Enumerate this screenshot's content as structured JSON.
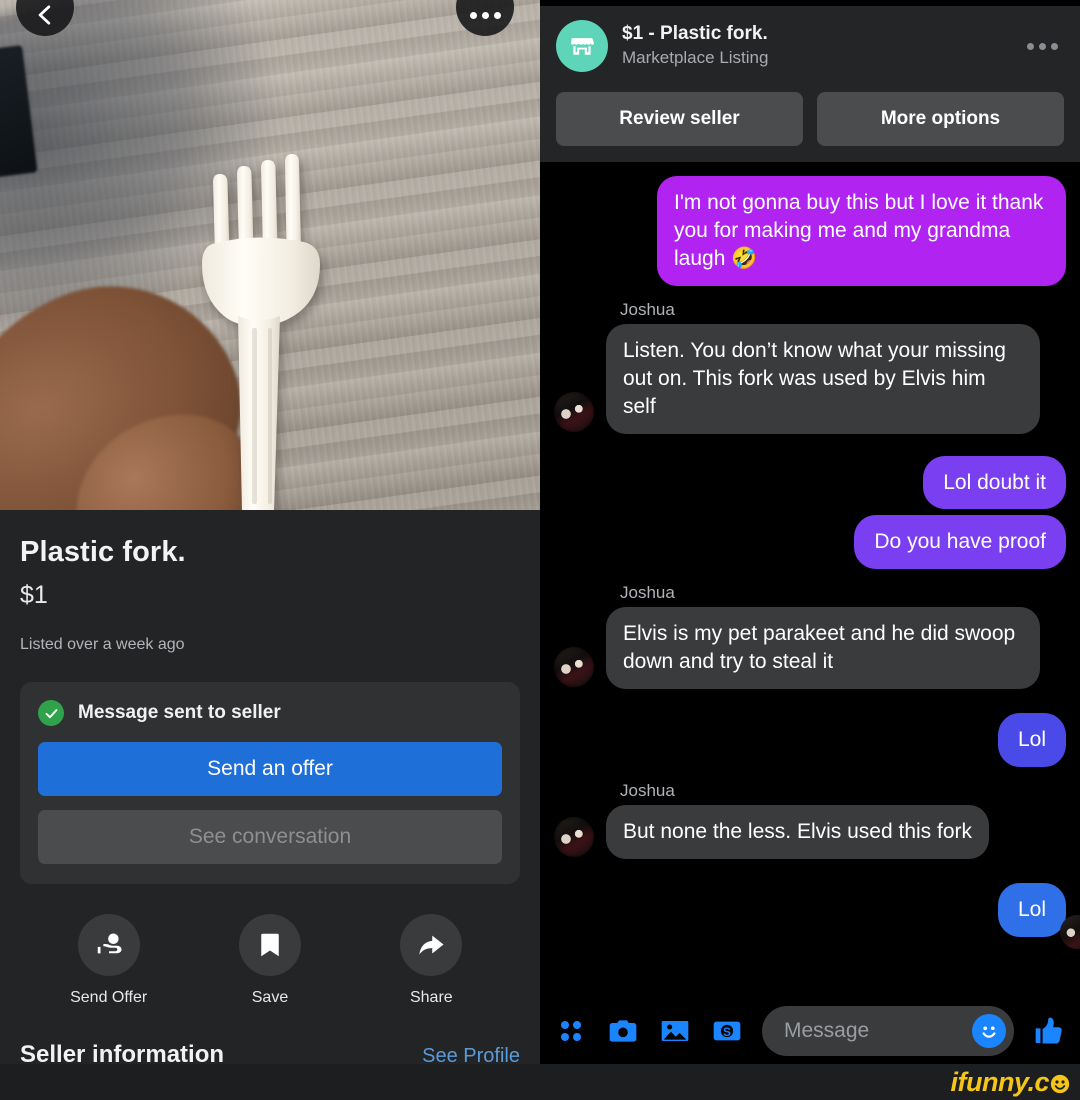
{
  "listing": {
    "back_icon": "back-arrow-icon",
    "more_icon": "overflow-menu-icon",
    "photo_alt": "white plastic fork held over gray wood plank floor",
    "title": "Plastic fork.",
    "price": "$1",
    "listed": "Listed over a week ago",
    "status_card": {
      "status_text": "Message sent to seller",
      "status_icon": "check-circle-icon",
      "primary_button": "Send an offer",
      "secondary_button": "See conversation"
    },
    "actions": [
      {
        "label": "Send Offer",
        "icon": "send-offer-icon"
      },
      {
        "label": "Save",
        "icon": "bookmark-icon"
      },
      {
        "label": "Share",
        "icon": "share-arrow-icon"
      }
    ],
    "seller_section": {
      "title": "Seller information",
      "link": "See Profile"
    }
  },
  "chat": {
    "header": {
      "avatar_icon": "marketplace-store-icon",
      "title": "$1 - Plastic fork.",
      "subtitle": "Marketplace Listing",
      "more_icon": "overflow-menu-icon",
      "buttons": [
        "Review seller",
        "More options"
      ]
    },
    "messages": [
      {
        "side": "out",
        "color": "magenta",
        "text": "I'm not gonna buy this but I love it thank you for making me and my grandma laugh 🤣"
      },
      {
        "side": "in",
        "sender": "Joshua",
        "color": "rx",
        "text": "Listen. You don’t know what your missing out on. This fork was used by Elvis him self"
      },
      {
        "side": "out",
        "color": "violet",
        "text": "Lol doubt it"
      },
      {
        "side": "out",
        "color": "violet",
        "text": "Do you have proof"
      },
      {
        "side": "in",
        "sender": "Joshua",
        "color": "rx",
        "text": "Elvis is my pet parakeet and he did swoop down and try to steal it"
      },
      {
        "side": "out",
        "color": "indigo",
        "text": "Lol"
      },
      {
        "side": "in",
        "sender": "Joshua",
        "color": "rx",
        "text": "But none the less. Elvis used this fork"
      },
      {
        "side": "out",
        "color": "blue",
        "text": "Lol"
      }
    ],
    "composer": {
      "icons": [
        "apps-grid-icon",
        "camera-icon",
        "photo-gallery-icon",
        "payment-dollar-icon"
      ],
      "placeholder": "Message",
      "emoji_icon": "emoji-smiley-icon",
      "like_icon": "thumbs-up-icon"
    }
  },
  "watermark": {
    "text": "ifunny.c",
    "icon": "smiley-o-icon"
  },
  "colors": {
    "messenger_blue": "#1b84ff",
    "bubble_magenta": "#b023f0",
    "bubble_violet": "#7b3ff2",
    "bubble_indigo": "#4a4ae8",
    "bubble_blue": "#2f6fe8",
    "bubble_received": "#3a3b3c",
    "store_teal": "#5ed4b8",
    "primary_button": "#1f6fd8",
    "check_green": "#31a24c",
    "link_blue": "#5b9bd9",
    "watermark_gold": "#f5c518"
  }
}
